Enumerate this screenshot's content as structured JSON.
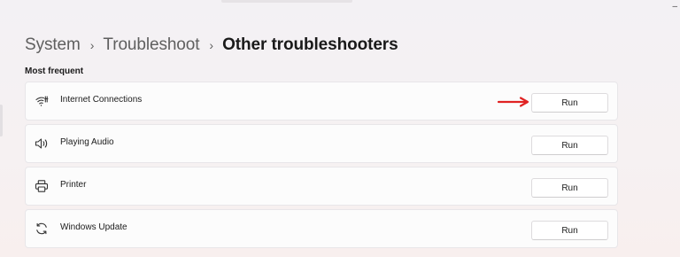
{
  "window": {
    "minimize_glyph": "–"
  },
  "breadcrumb": {
    "items": [
      "System",
      "Troubleshoot",
      "Other troubleshooters"
    ],
    "separator": "›"
  },
  "section": {
    "title": "Most frequent"
  },
  "troubleshooters": [
    {
      "label": "Internet Connections",
      "icon": "wifi-icon",
      "button_label": "Run",
      "highlighted": true
    },
    {
      "label": "Playing Audio",
      "icon": "speaker-icon",
      "button_label": "Run",
      "highlighted": false
    },
    {
      "label": "Printer",
      "icon": "printer-icon",
      "button_label": "Run",
      "highlighted": false
    },
    {
      "label": "Windows Update",
      "icon": "sync-icon",
      "button_label": "Run",
      "highlighted": false
    }
  ],
  "annotation": {
    "arrow_color": "#e02222"
  }
}
